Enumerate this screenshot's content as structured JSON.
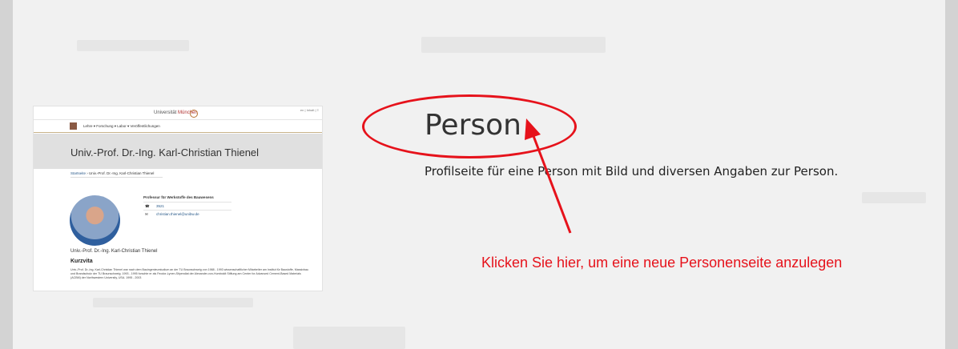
{
  "template": {
    "title": "Person",
    "description": "Profilseite für eine Person mit Bild und diversen Angaben zur Person."
  },
  "annotation": {
    "hint": "Klicken Sie hier, um eine neue Personenseite anzulegen",
    "color": "#e6121b"
  },
  "preview": {
    "university_prefix": "Universität",
    "university_name": "München",
    "lang_links": "en | Inhalt | ≡",
    "nav_items": "Lehre ▾   Forschung ▾   Labor ▾   Veröffentlichungen",
    "hero_title": "Univ.-Prof. Dr.-Ing. Karl-Christian Thienel",
    "breadcrumb_home": "Startseite",
    "breadcrumb_current": "Univ.-Prof. Dr.-Ing. Karl-Christian Thienel",
    "department": "Professur für Werkstoffe des Bauwesens",
    "phone": "3521",
    "email": "christian.thienel@unibw.de",
    "person_name": "Univ.-Prof. Dr.-Ing. Karl-Christian Thienel",
    "section_heading": "Kurzvita",
    "bio": "Univ.-Prof. Dr.-Ing. Karl-Christian Thienel war nach dem Bauingenieurstudium an der TU Braunschweig von 1988 - 1993 wissenschaftlicher Mitarbeiter am Institut für Baustoffe, Massivbau und Brandschutz der TU Braunschweig. 1993 - 1995 forschte er als Feodor-Lynen-Stipendiat der Alexander-von-Humboldt Stiftung am Center for Advanced Cement-Based Materials (ACBM) der Northwestern University, USA. 1995 - 2003"
  }
}
